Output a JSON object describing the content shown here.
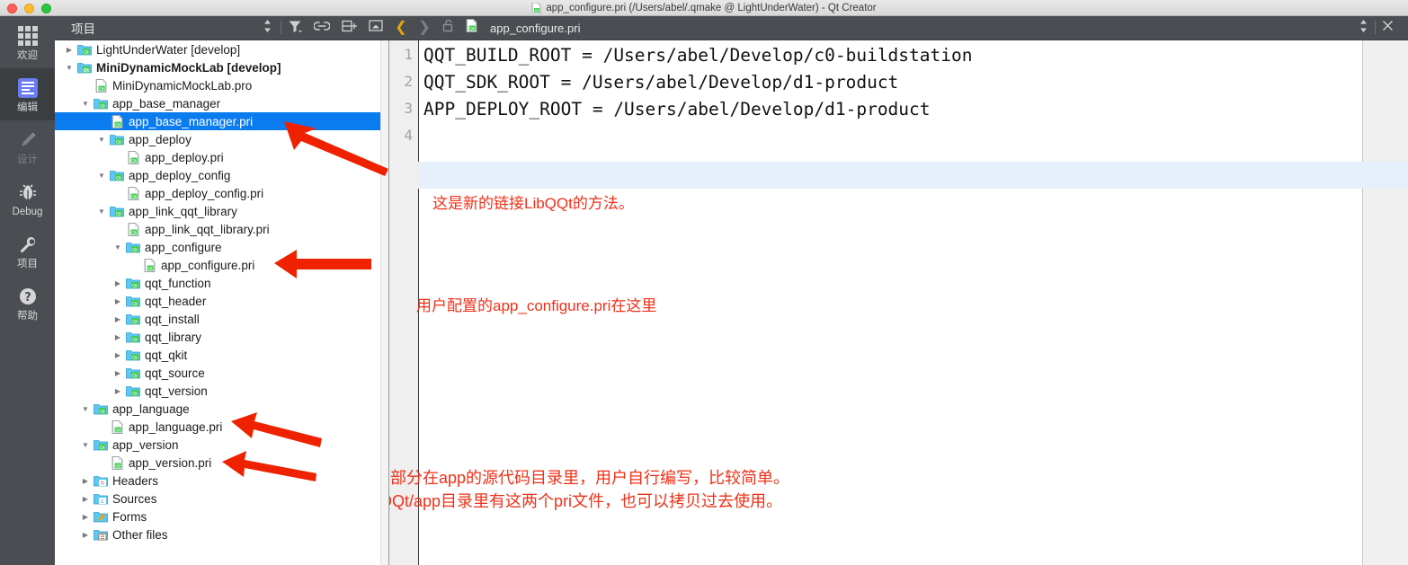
{
  "window": {
    "title": "app_configure.pri (/Users/abel/.qmake @ LightUnderWater) - Qt Creator",
    "traffic": {
      "close": "close",
      "minimize": "minimize",
      "zoom": "zoom"
    }
  },
  "modebar": {
    "items": [
      {
        "label": "欢迎",
        "icon": "grid-icon",
        "state": "normal"
      },
      {
        "label": "编辑",
        "icon": "edit-icon",
        "state": "active"
      },
      {
        "label": "设计",
        "icon": "pencil-icon",
        "state": "disabled"
      },
      {
        "label": "Debug",
        "icon": "bug-icon",
        "state": "normal"
      },
      {
        "label": "项目",
        "icon": "wrench-icon",
        "state": "normal"
      },
      {
        "label": "帮助",
        "icon": "question-icon",
        "state": "normal"
      }
    ]
  },
  "project_pane": {
    "title": "项目",
    "toolbar": [
      {
        "name": "sync-selector",
        "icon": "updown-arrows-icon"
      },
      {
        "name": "filter",
        "icon": "filter-icon"
      },
      {
        "name": "link-with-editor",
        "icon": "link-icon"
      },
      {
        "name": "split",
        "icon": "split-plus-icon"
      },
      {
        "name": "minimize-pane",
        "icon": "collapse-icon"
      }
    ],
    "tree": [
      {
        "label": "LightUnderWater [develop]",
        "indent": 0,
        "twisty": "collapsed",
        "icon": "qt-project-folder-icon",
        "bold": false,
        "selected": false
      },
      {
        "label": "MiniDynamicMockLab [develop]",
        "indent": 0,
        "twisty": "expanded",
        "icon": "qt-project-folder-icon",
        "bold": true,
        "selected": false
      },
      {
        "label": "MiniDynamicMockLab.pro",
        "indent": 1,
        "twisty": "none",
        "icon": "qt-file-icon",
        "bold": false,
        "selected": false
      },
      {
        "label": "app_base_manager",
        "indent": 1,
        "twisty": "expanded",
        "icon": "qt-project-folder-icon",
        "bold": false,
        "selected": false
      },
      {
        "label": "app_base_manager.pri",
        "indent": 2,
        "twisty": "none",
        "icon": "qt-file-icon",
        "bold": false,
        "selected": true
      },
      {
        "label": "app_deploy",
        "indent": 2,
        "twisty": "expanded",
        "icon": "qt-project-folder-icon",
        "bold": false,
        "selected": false
      },
      {
        "label": "app_deploy.pri",
        "indent": 3,
        "twisty": "none",
        "icon": "qt-file-icon",
        "bold": false,
        "selected": false
      },
      {
        "label": "app_deploy_config",
        "indent": 2,
        "twisty": "expanded",
        "icon": "qt-project-folder-icon",
        "bold": false,
        "selected": false
      },
      {
        "label": "app_deploy_config.pri",
        "indent": 3,
        "twisty": "none",
        "icon": "qt-file-icon",
        "bold": false,
        "selected": false
      },
      {
        "label": "app_link_qqt_library",
        "indent": 2,
        "twisty": "expanded",
        "icon": "qt-project-folder-icon",
        "bold": false,
        "selected": false
      },
      {
        "label": "app_link_qqt_library.pri",
        "indent": 3,
        "twisty": "none",
        "icon": "qt-file-icon",
        "bold": false,
        "selected": false
      },
      {
        "label": "app_configure",
        "indent": 3,
        "twisty": "expanded",
        "icon": "qt-project-folder-icon",
        "bold": false,
        "selected": false
      },
      {
        "label": "app_configure.pri",
        "indent": 4,
        "twisty": "none",
        "icon": "qt-file-icon",
        "bold": false,
        "selected": false
      },
      {
        "label": "qqt_function",
        "indent": 3,
        "twisty": "collapsed",
        "icon": "qt-project-folder-icon",
        "bold": false,
        "selected": false
      },
      {
        "label": "qqt_header",
        "indent": 3,
        "twisty": "collapsed",
        "icon": "qt-project-folder-icon",
        "bold": false,
        "selected": false
      },
      {
        "label": "qqt_install",
        "indent": 3,
        "twisty": "collapsed",
        "icon": "qt-project-folder-icon",
        "bold": false,
        "selected": false
      },
      {
        "label": "qqt_library",
        "indent": 3,
        "twisty": "collapsed",
        "icon": "qt-project-folder-icon",
        "bold": false,
        "selected": false
      },
      {
        "label": "qqt_qkit",
        "indent": 3,
        "twisty": "collapsed",
        "icon": "qt-project-folder-icon",
        "bold": false,
        "selected": false
      },
      {
        "label": "qqt_source",
        "indent": 3,
        "twisty": "collapsed",
        "icon": "qt-project-folder-icon",
        "bold": false,
        "selected": false
      },
      {
        "label": "qqt_version",
        "indent": 3,
        "twisty": "collapsed",
        "icon": "qt-project-folder-icon",
        "bold": false,
        "selected": false
      },
      {
        "label": "app_language",
        "indent": 1,
        "twisty": "expanded",
        "icon": "qt-project-folder-icon",
        "bold": false,
        "selected": false
      },
      {
        "label": "app_language.pri",
        "indent": 2,
        "twisty": "none",
        "icon": "qt-file-icon",
        "bold": false,
        "selected": false
      },
      {
        "label": "app_version",
        "indent": 1,
        "twisty": "expanded",
        "icon": "qt-project-folder-icon",
        "bold": false,
        "selected": false
      },
      {
        "label": "app_version.pri",
        "indent": 2,
        "twisty": "none",
        "icon": "qt-file-icon",
        "bold": false,
        "selected": false
      },
      {
        "label": "Headers",
        "indent": 1,
        "twisty": "collapsed",
        "icon": "headers-folder-icon",
        "bold": false,
        "selected": false
      },
      {
        "label": "Sources",
        "indent": 1,
        "twisty": "collapsed",
        "icon": "sources-folder-icon",
        "bold": false,
        "selected": false
      },
      {
        "label": "Forms",
        "indent": 1,
        "twisty": "collapsed",
        "icon": "forms-folder-icon",
        "bold": false,
        "selected": false
      },
      {
        "label": "Other files",
        "indent": 1,
        "twisty": "collapsed",
        "icon": "other-files-folder-icon",
        "bold": false,
        "selected": false
      }
    ]
  },
  "editor_toolbar": {
    "back": "back-chevron-icon",
    "forward": "forward-chevron-icon",
    "lock": "unlocked-padlock-icon",
    "file_icon": "qt-file-icon",
    "filename": "app_configure.pri",
    "selector": "updown-arrows-icon",
    "close": "close-x-icon"
  },
  "editor": {
    "line_numbers": [
      "1",
      "2",
      "3",
      "4"
    ],
    "lines": [
      "QQT_BUILD_ROOT = /Users/abel/Develop/c0-buildstation",
      "QQT_SDK_ROOT = /Users/abel/Develop/d1-product",
      "APP_DEPLOY_ROOT = /Users/abel/Develop/d1-product",
      ""
    ],
    "current_line": 4,
    "annotations": [
      "这是新的链接LibQQt的方法。",
      "用户配置的app_configure.pri在这里",
      "这个部分在app的源代码目录里，用户自行编写，比较简单。",
      "LibQQt/app目录里有这两个pri文件，也可以拷贝过去使用。"
    ]
  },
  "colors": {
    "chrome": "#4a4e52",
    "selection_blue": "#0a7cf0",
    "annotation_red": "#f03018",
    "current_line": "#e6f0fb",
    "accent_yellow": "#e5a80c"
  }
}
